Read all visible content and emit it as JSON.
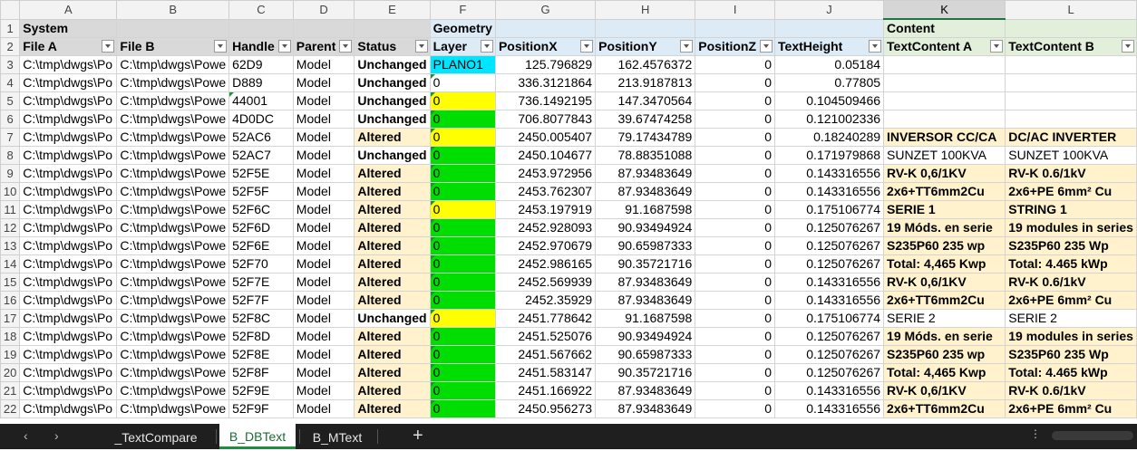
{
  "columns": [
    "A",
    "B",
    "C",
    "D",
    "E",
    "F",
    "G",
    "H",
    "I",
    "J",
    "K",
    "L"
  ],
  "group_row": {
    "system": "System",
    "geometry": "Geometry",
    "content": "Content"
  },
  "headers": [
    "File A",
    "File B",
    "Handle",
    "Parent",
    "Status",
    "Layer",
    "PositionX",
    "PositionY",
    "PositionZ",
    "TextHeight",
    "TextContent A",
    "TextContent B"
  ],
  "rows": [
    {
      "n": "3",
      "a": "C:\\tmp\\dwgs\\Po",
      "b": "C:\\tmp\\dwgs\\Powe",
      "c": "62D9",
      "d": "Model",
      "e": "Unchanged",
      "f": "PLANO1",
      "g": "125.796829",
      "h": "162.4576372",
      "i": "0",
      "j": "0.05184",
      "k": "",
      "l": "",
      "layer_color": "cyan",
      "altered": false
    },
    {
      "n": "4",
      "a": "C:\\tmp\\dwgs\\Po",
      "b": "C:\\tmp\\dwgs\\Powe",
      "c": "D889",
      "d": "Model",
      "e": "Unchanged",
      "f": "0",
      "g": "336.3121864",
      "h": "213.9187813",
      "i": "0",
      "j": "0.77805",
      "k": "",
      "l": "",
      "layer_color": "none",
      "altered": false
    },
    {
      "n": "5",
      "a": "C:\\tmp\\dwgs\\Po",
      "b": "C:\\tmp\\dwgs\\Powe",
      "c": "44001",
      "d": "Model",
      "e": "Unchanged",
      "f": "0",
      "g": "736.1492195",
      "h": "147.3470564",
      "i": "0",
      "j": "0.104509466",
      "k": "",
      "l": "",
      "layer_color": "yellow",
      "altered": false
    },
    {
      "n": "6",
      "a": "C:\\tmp\\dwgs\\Po",
      "b": "C:\\tmp\\dwgs\\Powe",
      "c": "4D0DC",
      "d": "Model",
      "e": "Unchanged",
      "f": "0",
      "g": "706.8077843",
      "h": "39.67474258",
      "i": "0",
      "j": "0.121002336",
      "k": "",
      "l": "",
      "layer_color": "green",
      "altered": false
    },
    {
      "n": "7",
      "a": "C:\\tmp\\dwgs\\Po",
      "b": "C:\\tmp\\dwgs\\Powe",
      "c": "52AC6",
      "d": "Model",
      "e": "Altered",
      "f": "0",
      "g": "2450.005407",
      "h": "79.17434789",
      "i": "0",
      "j": "0.18240289",
      "k": "INVERSOR CC/CA",
      "l": "DC/AC INVERTER",
      "layer_color": "yellow",
      "altered": true
    },
    {
      "n": "8",
      "a": "C:\\tmp\\dwgs\\Po",
      "b": "C:\\tmp\\dwgs\\Powe",
      "c": "52AC7",
      "d": "Model",
      "e": "Unchanged",
      "f": "0",
      "g": "2450.104677",
      "h": "78.88351088",
      "i": "0",
      "j": "0.171979868",
      "k": "SUNZET 100KVA",
      "l": "SUNZET 100KVA",
      "layer_color": "green",
      "altered": false
    },
    {
      "n": "9",
      "a": "C:\\tmp\\dwgs\\Po",
      "b": "C:\\tmp\\dwgs\\Powe",
      "c": "52F5E",
      "d": "Model",
      "e": "Altered",
      "f": "0",
      "g": "2453.972956",
      "h": "87.93483649",
      "i": "0",
      "j": "0.143316556",
      "k": "RV-K 0,6/1KV",
      "l": "RV-K 0.6/1kV",
      "layer_color": "green",
      "altered": true
    },
    {
      "n": "10",
      "a": "C:\\tmp\\dwgs\\Po",
      "b": "C:\\tmp\\dwgs\\Powe",
      "c": "52F5F",
      "d": "Model",
      "e": "Altered",
      "f": "0",
      "g": "2453.762307",
      "h": "87.93483649",
      "i": "0",
      "j": "0.143316556",
      "k": "2x6+TT6mm2Cu",
      "l": "2x6+PE 6mm² Cu",
      "layer_color": "green",
      "altered": true
    },
    {
      "n": "11",
      "a": "C:\\tmp\\dwgs\\Po",
      "b": "C:\\tmp\\dwgs\\Powe",
      "c": "52F6C",
      "d": "Model",
      "e": "Altered",
      "f": "0",
      "g": "2453.197919",
      "h": "91.1687598",
      "i": "0",
      "j": "0.175106774",
      "k": "SERIE 1",
      "l": "STRING 1",
      "layer_color": "yellow",
      "altered": true
    },
    {
      "n": "12",
      "a": "C:\\tmp\\dwgs\\Po",
      "b": "C:\\tmp\\dwgs\\Powe",
      "c": "52F6D",
      "d": "Model",
      "e": "Altered",
      "f": "0",
      "g": "2452.928093",
      "h": "90.93494924",
      "i": "0",
      "j": "0.125076267",
      "k": "19 Móds. en serie",
      "l": "19 modules in series",
      "layer_color": "green",
      "altered": true
    },
    {
      "n": "13",
      "a": "C:\\tmp\\dwgs\\Po",
      "b": "C:\\tmp\\dwgs\\Powe",
      "c": "52F6E",
      "d": "Model",
      "e": "Altered",
      "f": "0",
      "g": "2452.970679",
      "h": "90.65987333",
      "i": "0",
      "j": "0.125076267",
      "k": "S235P60 235 wp",
      "l": "S235P60 235 Wp",
      "layer_color": "green",
      "altered": true
    },
    {
      "n": "14",
      "a": "C:\\tmp\\dwgs\\Po",
      "b": "C:\\tmp\\dwgs\\Powe",
      "c": "52F70",
      "d": "Model",
      "e": "Altered",
      "f": "0",
      "g": "2452.986165",
      "h": "90.35721716",
      "i": "0",
      "j": "0.125076267",
      "k": "Total: 4,465 Kwp",
      "l": "Total: 4.465 kWp",
      "layer_color": "green",
      "altered": true
    },
    {
      "n": "15",
      "a": "C:\\tmp\\dwgs\\Po",
      "b": "C:\\tmp\\dwgs\\Powe",
      "c": "52F7E",
      "d": "Model",
      "e": "Altered",
      "f": "0",
      "g": "2452.569939",
      "h": "87.93483649",
      "i": "0",
      "j": "0.143316556",
      "k": "RV-K 0,6/1KV",
      "l": "RV-K 0.6/1kV",
      "layer_color": "green",
      "altered": true
    },
    {
      "n": "16",
      "a": "C:\\tmp\\dwgs\\Po",
      "b": "C:\\tmp\\dwgs\\Powe",
      "c": "52F7F",
      "d": "Model",
      "e": "Altered",
      "f": "0",
      "g": "2452.35929",
      "h": "87.93483649",
      "i": "0",
      "j": "0.143316556",
      "k": "2x6+TT6mm2Cu",
      "l": "2x6+PE 6mm² Cu",
      "layer_color": "green",
      "altered": true
    },
    {
      "n": "17",
      "a": "C:\\tmp\\dwgs\\Po",
      "b": "C:\\tmp\\dwgs\\Powe",
      "c": "52F8C",
      "d": "Model",
      "e": "Unchanged",
      "f": "0",
      "g": "2451.778642",
      "h": "91.1687598",
      "i": "0",
      "j": "0.175106774",
      "k": "SERIE 2",
      "l": "SERIE 2",
      "layer_color": "yellow",
      "altered": false
    },
    {
      "n": "18",
      "a": "C:\\tmp\\dwgs\\Po",
      "b": "C:\\tmp\\dwgs\\Powe",
      "c": "52F8D",
      "d": "Model",
      "e": "Altered",
      "f": "0",
      "g": "2451.525076",
      "h": "90.93494924",
      "i": "0",
      "j": "0.125076267",
      "k": "19 Móds. en serie",
      "l": "19 modules in series",
      "layer_color": "green",
      "altered": true
    },
    {
      "n": "19",
      "a": "C:\\tmp\\dwgs\\Po",
      "b": "C:\\tmp\\dwgs\\Powe",
      "c": "52F8E",
      "d": "Model",
      "e": "Altered",
      "f": "0",
      "g": "2451.567662",
      "h": "90.65987333",
      "i": "0",
      "j": "0.125076267",
      "k": "S235P60 235 wp",
      "l": "S235P60 235 Wp",
      "layer_color": "green",
      "altered": true
    },
    {
      "n": "20",
      "a": "C:\\tmp\\dwgs\\Po",
      "b": "C:\\tmp\\dwgs\\Powe",
      "c": "52F8F",
      "d": "Model",
      "e": "Altered",
      "f": "0",
      "g": "2451.583147",
      "h": "90.35721716",
      "i": "0",
      "j": "0.125076267",
      "k": "Total: 4,465 Kwp",
      "l": "Total: 4.465 kWp",
      "layer_color": "green",
      "altered": true
    },
    {
      "n": "21",
      "a": "C:\\tmp\\dwgs\\Po",
      "b": "C:\\tmp\\dwgs\\Powe",
      "c": "52F9E",
      "d": "Model",
      "e": "Altered",
      "f": "0",
      "g": "2451.166922",
      "h": "87.93483649",
      "i": "0",
      "j": "0.143316556",
      "k": "RV-K 0,6/1KV",
      "l": "RV-K 0.6/1kV",
      "layer_color": "green",
      "altered": true
    },
    {
      "n": "22",
      "a": "C:\\tmp\\dwgs\\Po",
      "b": "C:\\tmp\\dwgs\\Powe",
      "c": "52F9F",
      "d": "Model",
      "e": "Altered",
      "f": "0",
      "g": "2450.956273",
      "h": "87.93483649",
      "i": "0",
      "j": "0.143316556",
      "k": "2x6+TT6mm2Cu",
      "l": "2x6+PE 6mm² Cu",
      "layer_color": "green",
      "altered": true
    }
  ],
  "sheet_tabs": [
    {
      "label": "_TextCompare",
      "active": false
    },
    {
      "label": "B_DBText",
      "active": true
    },
    {
      "label": "B_MText",
      "active": false
    }
  ],
  "colors": {
    "altered_fill": "#fff2cc",
    "layer_green": "#00dd00",
    "layer_yellow": "#ffff00",
    "layer_cyan": "#00e5ff",
    "active_tab_accent": "#1e8f3a"
  }
}
